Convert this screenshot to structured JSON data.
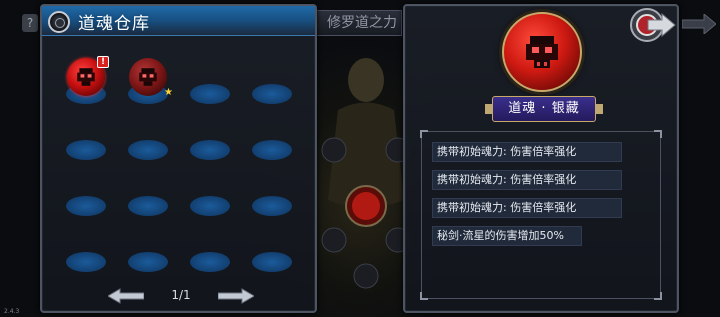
{
  "background": {
    "help_glyph": "?",
    "side_label": "修罗道之力",
    "version": "2.4.3"
  },
  "storage": {
    "title": "道魂仓库",
    "items": [
      {
        "slot": 0,
        "state": "active",
        "badge": "!",
        "icon": "skull-emblem-icon"
      },
      {
        "slot": 1,
        "state": "inactive",
        "badge": "★",
        "icon": "skull-emblem-icon"
      }
    ],
    "slot_count": 16,
    "page": "1/1"
  },
  "detail": {
    "name": "道魂 · 银藏",
    "icon": "skull-emblem-icon",
    "effects": [
      "携带初始魂力: 伤害倍率强化",
      "携带初始魂力: 伤害倍率强化",
      "携带初始魂力: 伤害倍率强化",
      "秘剑·流星的伤害增加50%"
    ]
  },
  "colors": {
    "header_blue": "#1f6aa8",
    "slot_blue": "#1b5b9a",
    "soul_red": "#cf1a12",
    "badge_red": "#d7221f",
    "star_gold": "#ffd43a",
    "plate_purple": "#2f2475",
    "effect_row": "#212a3a"
  }
}
